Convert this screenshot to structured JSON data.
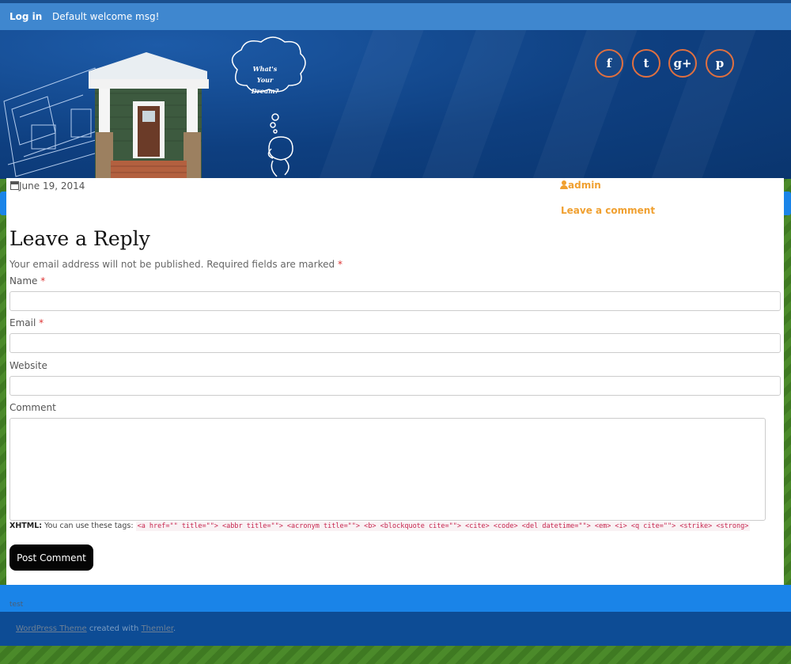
{
  "topbar": {
    "login_label": "Log in",
    "welcome": "Default welcome msg!"
  },
  "header": {
    "cloud_text": "What's Your Dream?",
    "social": [
      {
        "name": "facebook",
        "glyph": "f"
      },
      {
        "name": "twitter",
        "glyph": "t"
      },
      {
        "name": "google-plus",
        "glyph": "g+"
      },
      {
        "name": "pinterest",
        "glyph": "p"
      }
    ],
    "accent": "#e07040"
  },
  "post_meta": {
    "date": "June 19, 2014",
    "author": "admin",
    "comment_link": "Leave a comment"
  },
  "comment_form": {
    "title": "Leave a Reply",
    "notes": "Your email address will not be published. Required fields are marked",
    "required_mark": "*",
    "name_label": "Name",
    "email_label": "Email",
    "website_label": "Website",
    "comment_label": "Comment",
    "allowed_label": "XHTML:",
    "allowed_text": "You can use these tags:",
    "allowed_tags": "<a href=\"\" title=\"\"> <abbr title=\"\"> <acronym title=\"\"> <b> <blockquote cite=\"\"> <cite> <code> <del datetime=\"\"> <em> <i> <q cite=\"\"> <strike> <strong>",
    "submit_label": "Post Comment"
  },
  "footer": {
    "test_text": "test",
    "theme_link": "WordPress Theme",
    "created_with": "created with",
    "themler_link": "Themler",
    "period": "."
  }
}
